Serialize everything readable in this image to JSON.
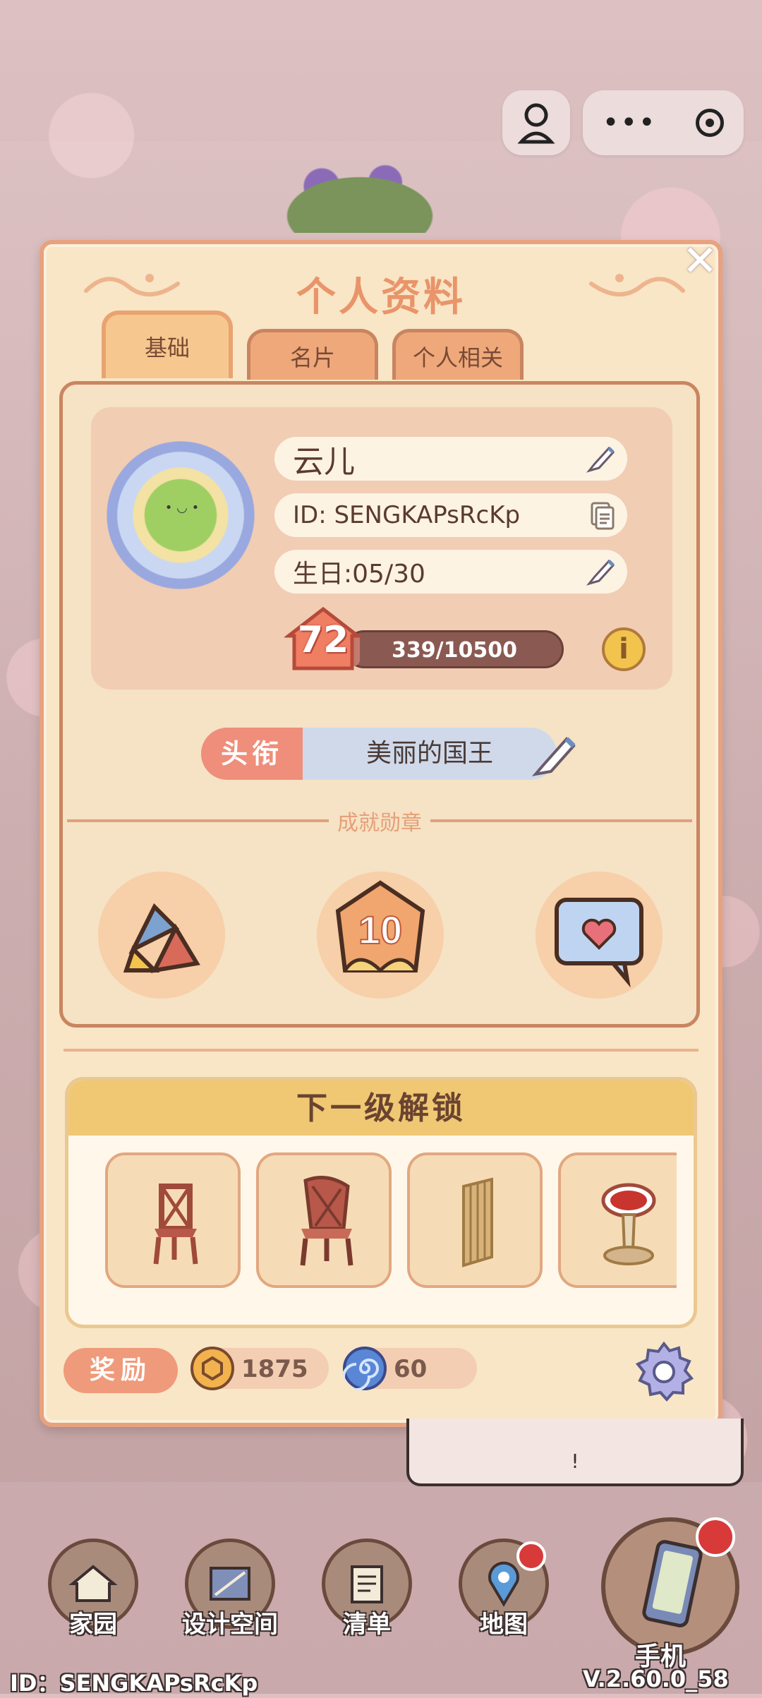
{
  "top_controls": {
    "more_icon": "ellipsis-icon",
    "close_icon": "target-icon",
    "user_icon": "user-icon"
  },
  "panel": {
    "title": "个人资料",
    "tabs": [
      {
        "label": "基础",
        "active": true
      },
      {
        "label": "名片",
        "active": false
      },
      {
        "label": "个人相关",
        "active": false
      }
    ]
  },
  "profile": {
    "name": "云儿",
    "id": "ID: SENGKAPsRcKp",
    "birthday": "生日:05/30",
    "level": "72",
    "xp_text": "339/10500",
    "xp_progress": 0.032
  },
  "title": {
    "tag": "头衔",
    "value": "美丽的国王"
  },
  "achievements": {
    "label": "成就勋章",
    "medal_center_text": "10"
  },
  "unlock": {
    "title": "下一级解锁"
  },
  "rewards": {
    "label": "奖励",
    "coins": "1875",
    "gems": "60"
  },
  "background": {
    "bubble_text": "!"
  },
  "bottom_nav": [
    {
      "label": "家园"
    },
    {
      "label": "设计空间"
    },
    {
      "label": "清单"
    },
    {
      "label": "地图"
    },
    {
      "label": "手机"
    }
  ],
  "footer": {
    "id": "ID：SENGKAPsRcKp",
    "version": "V.2.60.0_58"
  },
  "colors": {
    "panel_bg": "#f8e6c6",
    "border": "#e8a27e",
    "accent_title": "#e9946a",
    "title_tag": "#ef8e7a"
  }
}
